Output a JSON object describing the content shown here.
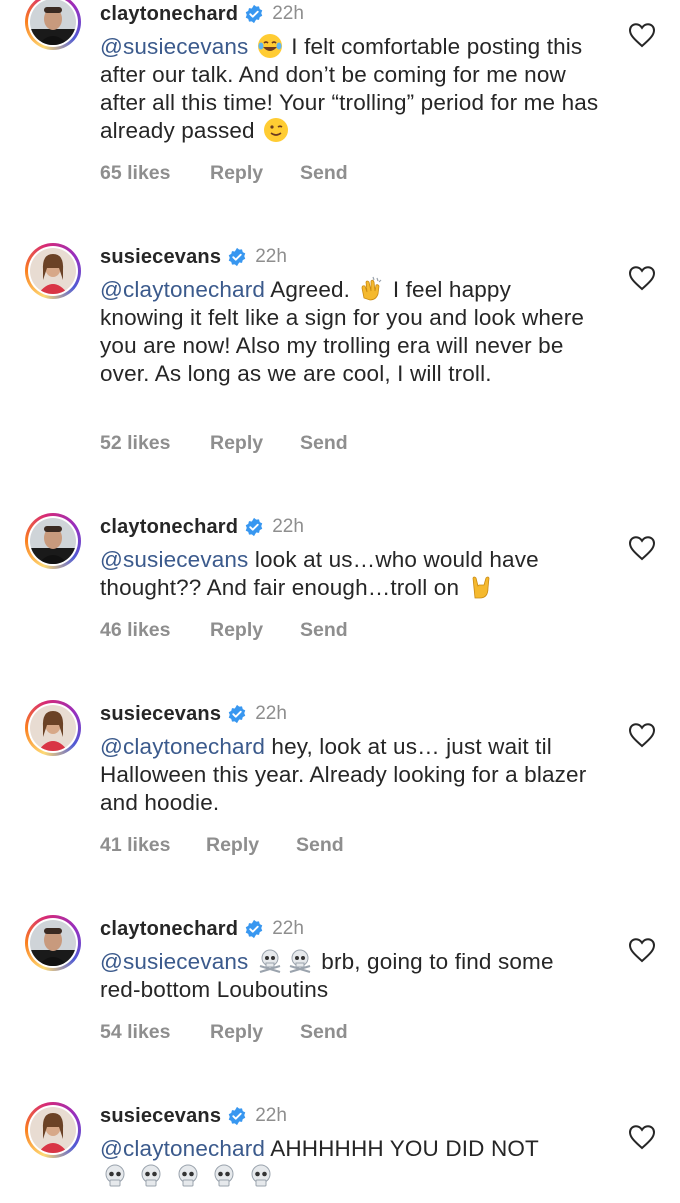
{
  "comments": [
    {
      "username": "claytonechard",
      "time": "22h",
      "mention": "@susiecevans",
      "text_before_emoji": "",
      "text_after_emoji": " I felt comfortable posting this after our talk. And don’t be coming for me now after all this time! Your “trolling” period for me has already passed ",
      "likes": "65 likes",
      "reply": "Reply",
      "send": "Send"
    },
    {
      "username": "susiecevans",
      "time": "22h",
      "mention": "@claytonechard",
      "text_before_emoji": " Agreed. ",
      "text_after_emoji": " I feel happy knowing it felt like a sign for you and look where you are now! Also my trolling era will never be over. As long as we are cool, I will troll.",
      "likes": "52 likes",
      "reply": "Reply",
      "send": "Send"
    },
    {
      "username": "claytonechard",
      "time": "22h",
      "mention": "@susiecevans",
      "text_before_emoji": " look at us…who would have thought?? And fair enough…troll on ",
      "text_after_emoji": "",
      "likes": "46 likes",
      "reply": "Reply",
      "send": "Send"
    },
    {
      "username": "susiecevans",
      "time": "22h",
      "mention": "@claytonechard",
      "text_before_emoji": " hey, look at us… just wait til Halloween this year. Already looking for a blazer and hoodie.",
      "text_after_emoji": "",
      "likes": "41 likes",
      "reply": "Reply",
      "send": "Send"
    },
    {
      "username": "claytonechard",
      "time": "22h",
      "mention": "@susiecevans",
      "text_before_emoji": " ",
      "text_after_emoji": " brb, going to find some red-bottom Louboutins",
      "likes": "54 likes",
      "reply": "Reply",
      "send": "Send"
    },
    {
      "username": "susiecevans",
      "time": "22h",
      "mention": "@claytonechard",
      "text_before_emoji": " AHHHHHH YOU DID NOT",
      "text_after_emoji": "",
      "likes": "",
      "reply": "",
      "send": ""
    }
  ],
  "icons": {
    "verified": "verified-badge-icon",
    "like": "heart-outline-icon"
  },
  "colors": {
    "mention": "#3b5a8c",
    "verified": "#3897f0",
    "secondary_text": "#8e8e8e"
  }
}
